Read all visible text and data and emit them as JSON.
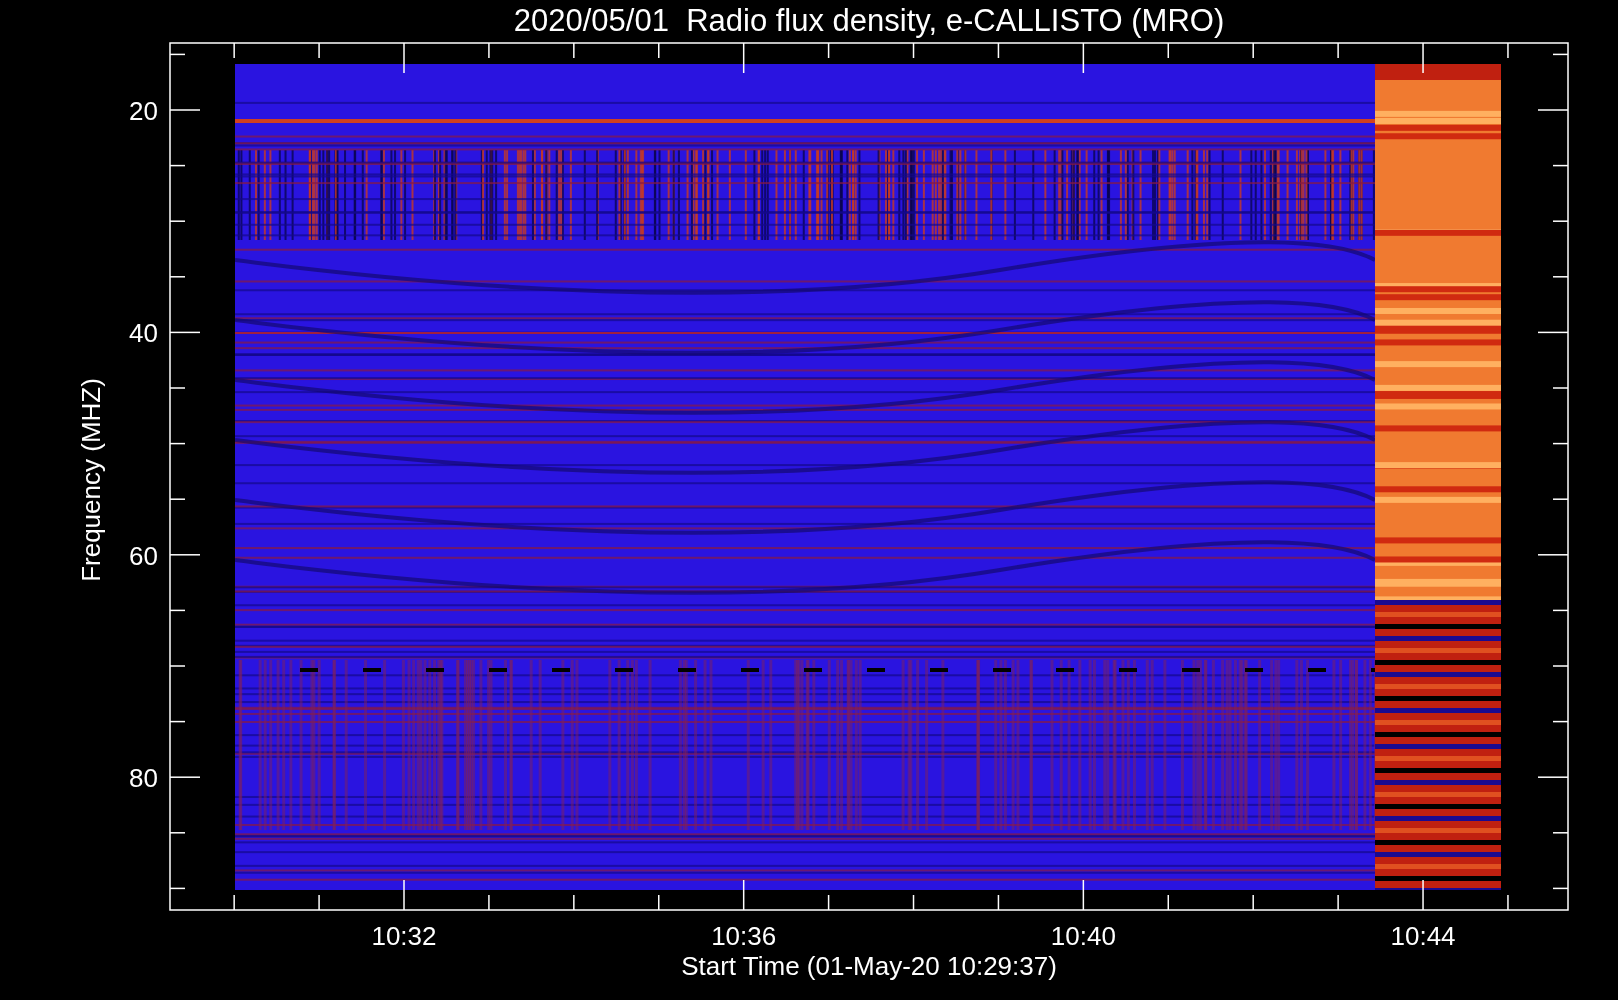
{
  "title": "2020/05/01  Radio flux density, e-CALLISTO (MRO)",
  "y_axis": {
    "label": "Frequency (MHZ)",
    "tick_labels": [
      "20",
      "40",
      "60",
      "80"
    ]
  },
  "x_axis": {
    "label": "Start Time (01-May-20 10:29:37)",
    "tick_labels": [
      "10:32",
      "10:36",
      "10:40",
      "10:44"
    ]
  }
}
